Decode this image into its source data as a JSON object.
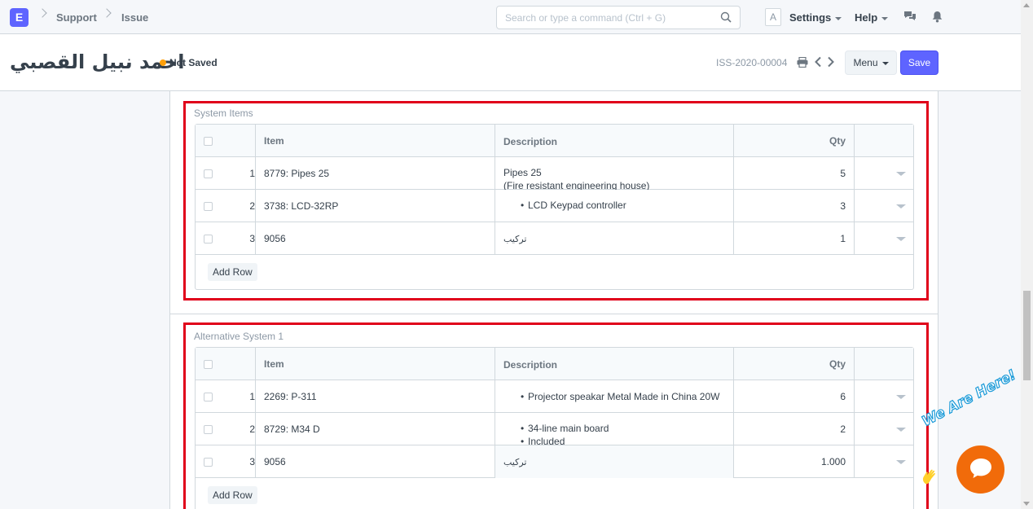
{
  "navbar": {
    "logo_letter": "E",
    "breadcrumbs": [
      "Support",
      "Issue"
    ],
    "search_placeholder": "Search or type a command (Ctrl + G)",
    "avatar_letter": "A",
    "settings_label": "Settings",
    "help_label": "Help"
  },
  "page_head": {
    "title": "احمد نبيل القصبي",
    "status": "Not Saved",
    "status_color": "#ffa00a",
    "doc_id": "ISS-2020-00004",
    "menu_label": "Menu",
    "save_label": "Save",
    "accent_color": "#5e64ff"
  },
  "sections": [
    {
      "label": "System Items",
      "columns": {
        "item": "Item",
        "description": "Description",
        "qty": "Qty"
      },
      "rows": [
        {
          "idx": "1",
          "item": "8779: Pipes 25",
          "desc_lines": [
            "Pipes 25",
            "(Fire resistant engineering house)"
          ],
          "qty": "5"
        },
        {
          "idx": "2",
          "item": "3738: LCD-32RP",
          "desc_bullets": [
            "LCD Keypad controller"
          ],
          "qty": "3"
        },
        {
          "idx": "3",
          "item": "9056",
          "desc_rtl": "تركيب",
          "qty": "1"
        }
      ],
      "add_row_label": "Add Row"
    },
    {
      "label": "Alternative System 1",
      "columns": {
        "item": "Item",
        "description": "Description",
        "qty": "Qty"
      },
      "rows": [
        {
          "idx": "1",
          "item": "2269: P-311",
          "desc_bullets": [
            "Projector speakar Metal Made in China 20W"
          ],
          "qty": "6"
        },
        {
          "idx": "2",
          "item": "8729: M34 D",
          "desc_bullets": [
            "34-line main board",
            "Included"
          ],
          "qty": "2"
        },
        {
          "idx": "3",
          "item": "9056",
          "desc_rtl": "تركيب",
          "qty": "1.000"
        }
      ],
      "add_row_label": "Add Row"
    }
  ],
  "chat_widget": {
    "banner_text": "We Are Here!",
    "bubble_color": "#f16b0a"
  },
  "highlight_color": "#e0001a"
}
